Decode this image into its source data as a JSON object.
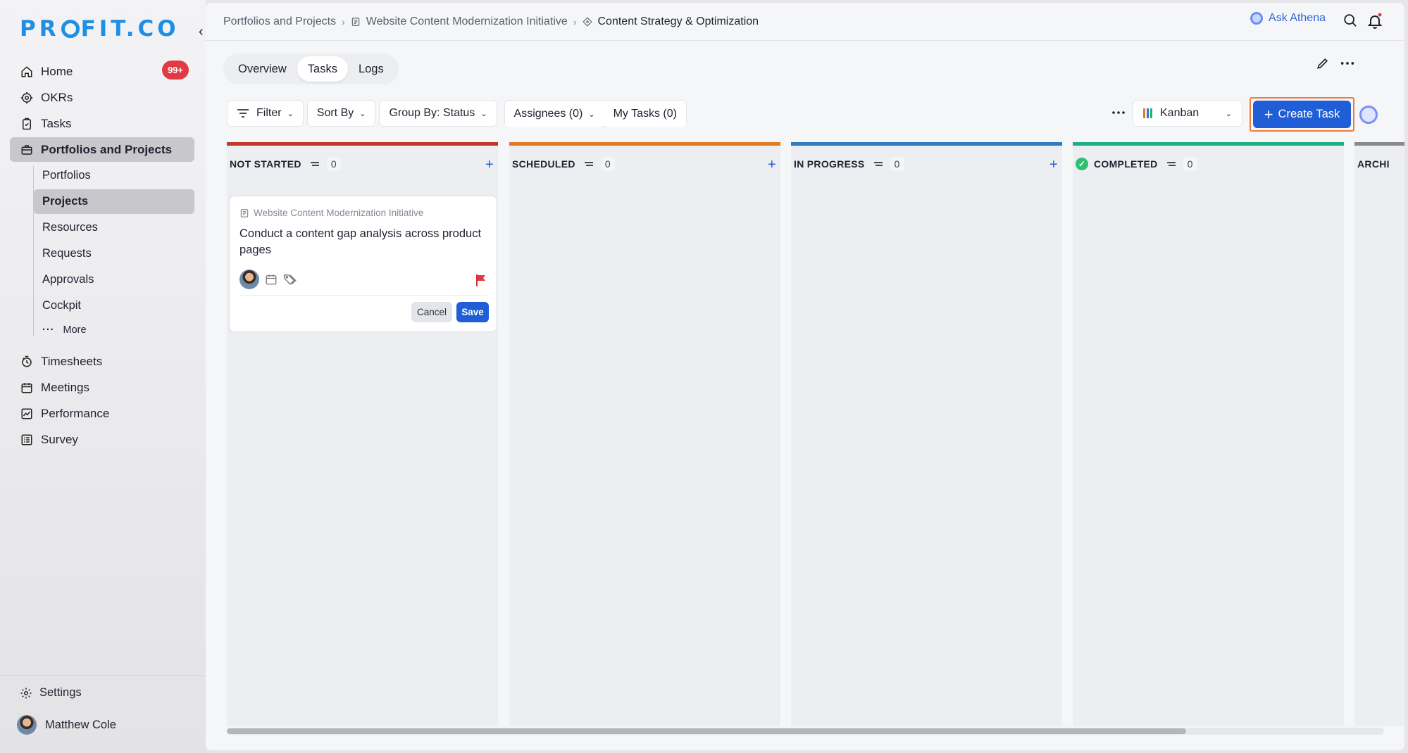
{
  "sidebar": {
    "logo": "PROFIT.CO",
    "logo_parts": [
      "PR",
      "FIT.CO"
    ],
    "nav": [
      {
        "label": "Home",
        "icon": "home-icon",
        "badge": "99+"
      },
      {
        "label": "OKRs",
        "icon": "target-icon"
      },
      {
        "label": "Tasks",
        "icon": "clipboard-icon"
      },
      {
        "label": "Portfolios and Projects",
        "icon": "briefcase-icon",
        "active": true
      }
    ],
    "sub": [
      {
        "label": "Portfolios"
      },
      {
        "label": "Projects",
        "active": true
      },
      {
        "label": "Resources"
      },
      {
        "label": "Requests"
      },
      {
        "label": "Approvals"
      },
      {
        "label": "Cockpit"
      }
    ],
    "more_label": "More",
    "nav2": [
      {
        "label": "Timesheets",
        "icon": "stopwatch-icon"
      },
      {
        "label": "Meetings",
        "icon": "calendar-icon"
      },
      {
        "label": "Performance",
        "icon": "chart-icon"
      },
      {
        "label": "Survey",
        "icon": "survey-icon"
      }
    ],
    "settings_label": "Settings",
    "user_name": "Matthew Cole"
  },
  "topbar": {
    "crumbs": [
      "Portfolios and Projects",
      "Website Content Modernization Initiative",
      "Content Strategy & Optimization"
    ],
    "ask_label": "Ask Athena"
  },
  "tabs": [
    "Overview",
    "Tasks",
    "Logs"
  ],
  "toolbar": {
    "filter": "Filter",
    "sort": "Sort By",
    "group": "Group By: Status",
    "assignees": "Assignees (0)",
    "my_tasks": "My Tasks (0)",
    "view": "Kanban",
    "create": "Create Task"
  },
  "columns": [
    {
      "title": "NOT STARTED",
      "count": "0",
      "color": "#c0392b"
    },
    {
      "title": "SCHEDULED",
      "count": "0",
      "color": "#e07b24"
    },
    {
      "title": "IN PROGRESS",
      "count": "0",
      "color": "#2e7bbf"
    },
    {
      "title": "COMPLETED",
      "count": "0",
      "color": "#1fae86"
    },
    {
      "title": "ARCHI",
      "color": "#8a8a8a"
    }
  ],
  "card": {
    "project": "Website Content Modernization Initiative",
    "title": "Conduct a content gap analysis across product pages",
    "cancel": "Cancel",
    "save": "Save"
  }
}
